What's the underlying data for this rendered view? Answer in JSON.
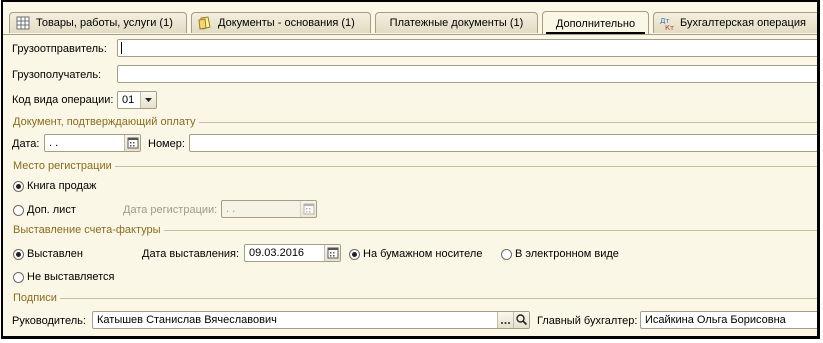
{
  "tabs": [
    {
      "label": "Товары, работы, услуги (1)",
      "icon": "table-icon"
    },
    {
      "label": "Документы - основания (1)",
      "icon": "document-icon"
    },
    {
      "label": "Платежные документы (1)",
      "icon": ""
    },
    {
      "label": "Дополнительно",
      "icon": ""
    },
    {
      "label": "Бухгалтерская операция",
      "icon": "accounting-entry-icon"
    }
  ],
  "shipper": {
    "label": "Грузоотправитель:",
    "value": ""
  },
  "consignee": {
    "label": "Грузополучатель:",
    "value": ""
  },
  "op_code": {
    "label": "Код вида операции:",
    "value": "01"
  },
  "payment_doc": {
    "section": "Документ, подтверждающий оплату",
    "date_label": "Дата:",
    "date_value": " .  .",
    "number_label": "Номер:",
    "number_value": ""
  },
  "registration": {
    "section": "Место регистрации",
    "option1": "Книга продаж",
    "option2": "Доп. лист",
    "reg_date_label": "Дата регистрации:",
    "reg_date_value": " .  .",
    "selected": "option1"
  },
  "invoice": {
    "section": "Выставление счета-фактуры",
    "issued": "Выставлен",
    "not_issued": "Не выставляется",
    "date_label": "Дата выставления:",
    "date_value": "09.03.2016",
    "paper": "На бумажном носителе",
    "electronic": "В электронном виде"
  },
  "signatures": {
    "section": "Подписи",
    "head_label": "Руководитель:",
    "head_value": "Катышев Станислав Вячеславович",
    "accountant_label": "Главный бухгалтер:",
    "accountant_value": "Исайкина Ольга Борисовна"
  }
}
